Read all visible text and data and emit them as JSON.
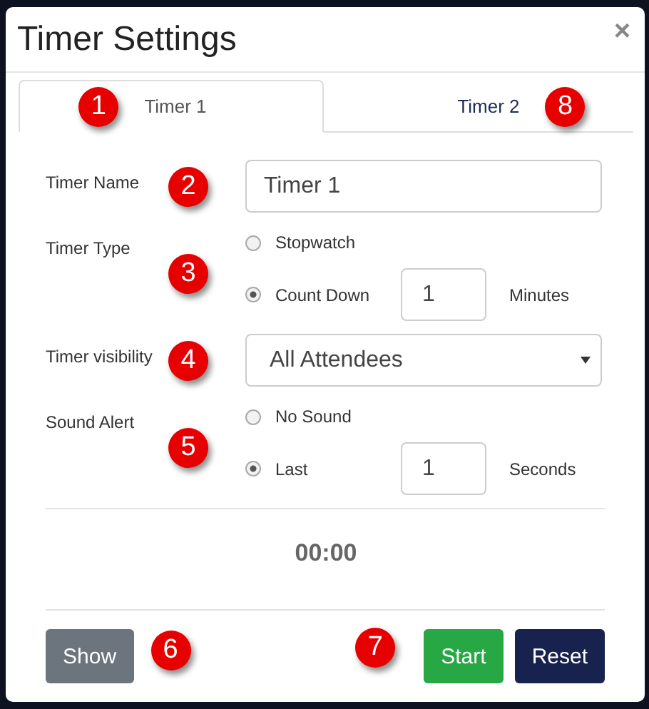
{
  "window": {
    "title": "Timer Settings",
    "close": "×"
  },
  "tabs": [
    {
      "label": "Timer 1",
      "selected": true,
      "callout": "1"
    },
    {
      "label": "Timer 2",
      "selected": false,
      "callout": "8"
    }
  ],
  "form": [
    {
      "kind": "text",
      "label": "Timer Name",
      "callout": "2",
      "value": "Timer 1"
    },
    {
      "kind": "radio",
      "label": "Timer Type",
      "callout": "3",
      "options": [
        {
          "label": "Stopwatch",
          "selected": false
        },
        {
          "label": "Count Down",
          "selected": true,
          "value": "1",
          "unit": "Minutes"
        }
      ]
    },
    {
      "kind": "select",
      "label": "Timer visibility",
      "callout": "4",
      "value": "All Attendees"
    },
    {
      "kind": "radio",
      "label": "Sound Alert",
      "callout": "5",
      "options": [
        {
          "label": "No Sound",
          "selected": false
        },
        {
          "label": "Last",
          "selected": true,
          "value": "1",
          "unit": "Seconds"
        }
      ]
    }
  ],
  "display": "00:00",
  "footer": {
    "left": [
      {
        "kind": "button",
        "label": "Show",
        "color": "#6c757d"
      },
      {
        "kind": "callout",
        "label": "6"
      }
    ],
    "right": [
      {
        "kind": "callout",
        "label": "7"
      },
      {
        "kind": "button",
        "label": "Start",
        "color": "#28a745"
      },
      {
        "kind": "button",
        "label": "Reset",
        "color": "#17234e"
      }
    ]
  }
}
